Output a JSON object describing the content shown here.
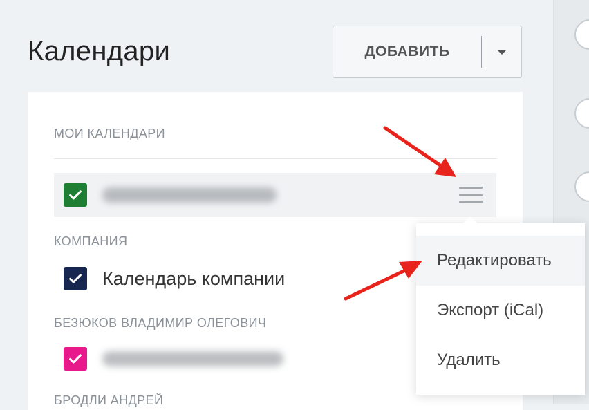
{
  "page": {
    "title": "Календари"
  },
  "add_button": {
    "label": "ДОБАВИТЬ"
  },
  "sections": {
    "my": {
      "title": "МОИ КАЛЕНДАРИ"
    },
    "company": {
      "title": "КОМПАНИЯ",
      "calendar_name": "Календарь компании"
    },
    "user": {
      "title": "БЕЗЮКОВ ВЛАДИМИР ОЛЕГОВИЧ"
    },
    "next": {
      "title": "БРОДЛИ АНДРЕЙ"
    }
  },
  "dropdown": {
    "items": [
      {
        "label": "Редактировать"
      },
      {
        "label": "Экспорт (iCal)"
      },
      {
        "label": "Удалить"
      }
    ]
  },
  "colors": {
    "green": "#1e7e34",
    "navy": "#17274f",
    "pink": "#e8198b",
    "arrow": "#e8231b"
  }
}
